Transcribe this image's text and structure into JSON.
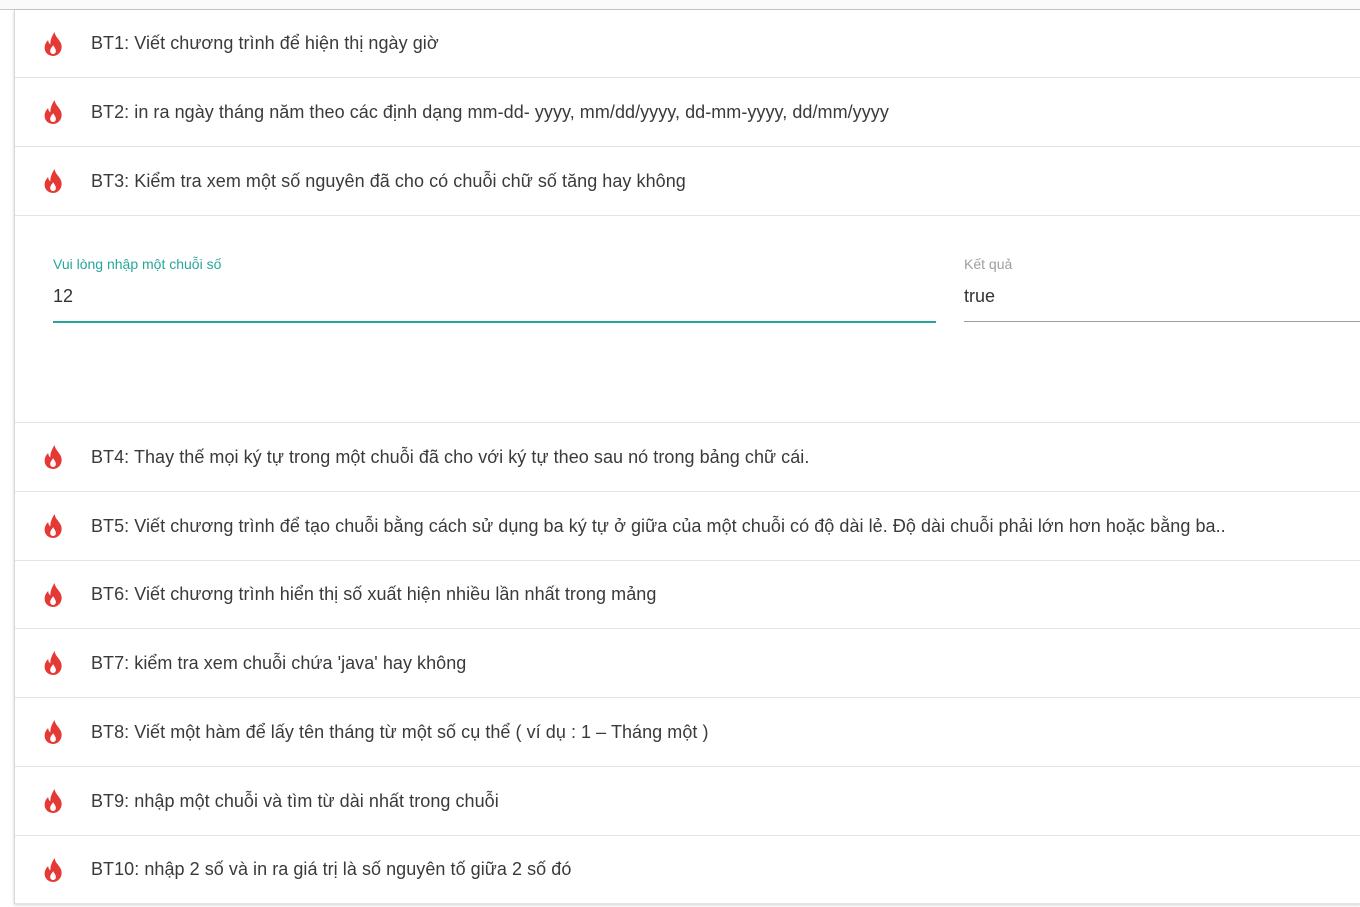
{
  "colors": {
    "accent": "#26a69a",
    "icon": "#e53935",
    "muted": "#9e9e9e"
  },
  "icon_name": "whatshot-icon",
  "exercises_top": [
    {
      "label": "BT1: Viết chương trình để hiện thị ngày giờ"
    },
    {
      "label": "BT2: in ra ngày tháng năm theo các định dạng mm-dd- yyyy, mm/dd/yyyy, dd-mm-yyyy, dd/mm/yyyy"
    },
    {
      "label": "BT3: Kiểm tra xem một số nguyên đã cho có chuỗi chữ số tăng hay không"
    }
  ],
  "expanded": {
    "input_label": "Vui lòng nhập một chuỗi số",
    "input_value": "12",
    "result_label": "Kết quả",
    "result_value": "true"
  },
  "exercises_bottom": [
    {
      "label": "BT4: Thay thế mọi ký tự trong một chuỗi đã cho với ký tự theo sau nó trong bảng chữ cái."
    },
    {
      "label": "BT5: Viết chương trình để tạo chuỗi bằng cách sử dụng ba ký tự ở giữa của một chuỗi có độ dài lẻ. Độ dài chuỗi phải lớn hơn hoặc bằng ba.."
    },
    {
      "label": "BT6: Viết chương trình hiển thị số xuất hiện nhiều lần nhất trong mảng"
    },
    {
      "label": "BT7: kiểm tra xem chuỗi chứa 'java' hay không"
    },
    {
      "label": "BT8: Viết một hàm để lấy tên tháng từ một số cụ thể ( ví dụ : 1 – Tháng một )"
    },
    {
      "label": "BT9: nhập một chuỗi và tìm từ dài nhất trong chuỗi"
    },
    {
      "label": "BT10: nhập 2 số và in ra giá trị là số nguyên tố giữa 2 số đó"
    }
  ]
}
